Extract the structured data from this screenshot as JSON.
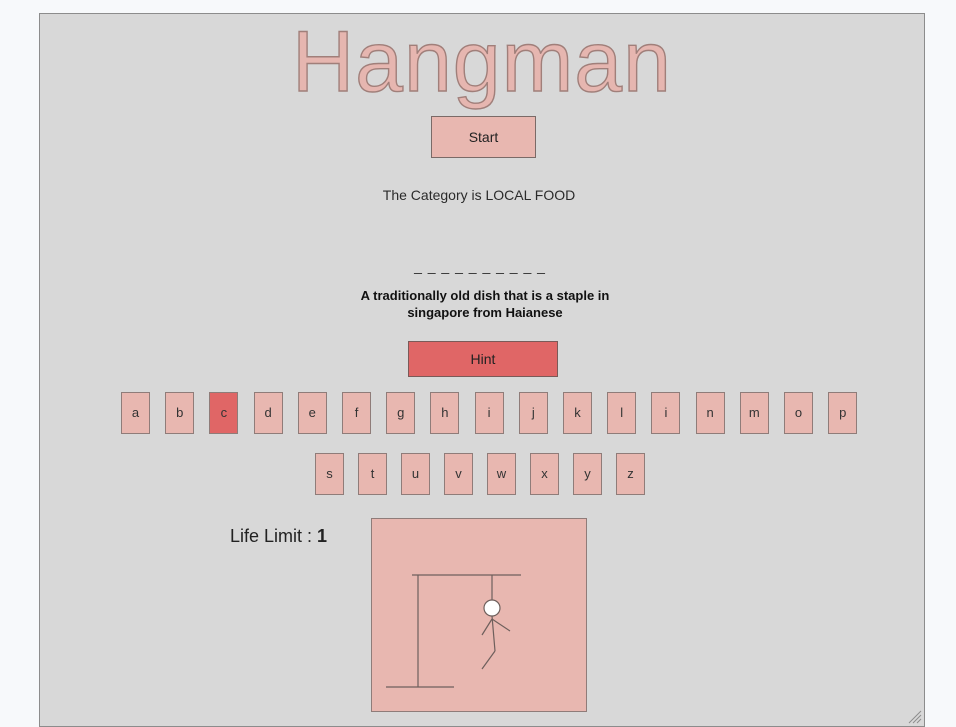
{
  "title": "Hangman",
  "start_label": "Start",
  "category_text": "The Category is LOCAL FOOD",
  "word_blanks": "_ _ _ _ _ _ _ _ _ _",
  "clue": "A traditionally old dish that is a staple in singapore from Haianese",
  "hint_label": "Hint",
  "keys_row1": [
    "a",
    "b",
    "c",
    "d",
    "e",
    "f",
    "g",
    "h",
    "i",
    "j",
    "k",
    "l",
    "i",
    "n",
    "m",
    "o",
    "p"
  ],
  "keys_row2": [
    "s",
    "t",
    "u",
    "v",
    "w",
    "x",
    "y",
    "z"
  ],
  "used_keys": [
    "c"
  ],
  "life": {
    "label": "Life Limit : ",
    "value": "1"
  },
  "colors": {
    "key": "#e8b7b0",
    "key_used": "#e06666",
    "hint": "#e06666",
    "panel": "#d8d8d8"
  }
}
